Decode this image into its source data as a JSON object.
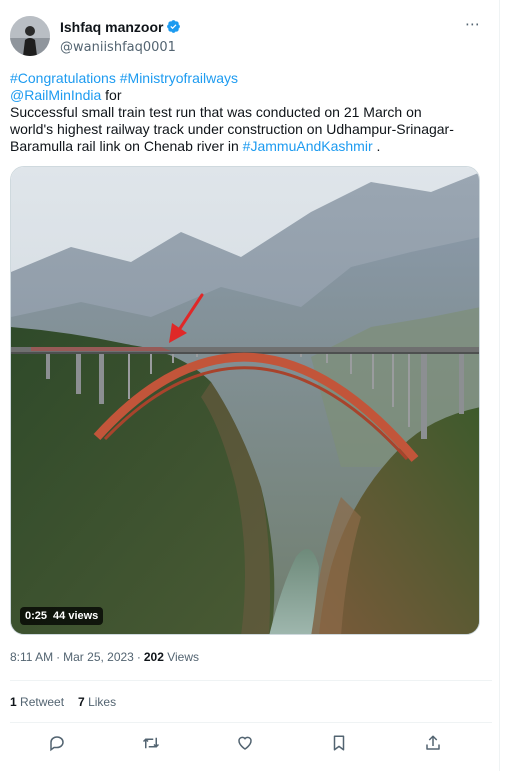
{
  "author": {
    "display_name": "Ishfaq manzoor",
    "handle": "@waniishfaq0001",
    "verified": true
  },
  "more_icon": "⋯",
  "tweet": {
    "line1": [
      {
        "text": "#Congratulations",
        "link": true
      },
      {
        "text": " ",
        "link": false
      },
      {
        "text": "#Ministryofrailways",
        "link": true
      }
    ],
    "line2_link": "@RailMinIndia",
    "line2_text": " for",
    "line3": "Successful small train test run that was conducted on 21 March on",
    "line4": "world's highest railway track under construction on Udhampur-Srinagar-",
    "line5_text": "Baramulla rail link on Chenab river in ",
    "line5_link": "#JammuAndKashmir",
    "line5_end": " ."
  },
  "video": {
    "duration": "0:25",
    "views": "44 views"
  },
  "meta": {
    "time": "8:11 AM",
    "separator": "·",
    "date": "Mar 25, 2023",
    "separator2": "·",
    "views_count": "202",
    "views_label": " Views"
  },
  "stats": {
    "retweet_count": "1",
    "retweet_label": " Retweet",
    "likes_count": "7",
    "likes_label": " Likes"
  },
  "actions": [
    "reply-icon",
    "retweet-icon",
    "like-icon",
    "bookmark-icon",
    "share-icon"
  ],
  "colors": {
    "link": "#1d9bf0",
    "secondary_text": "#536471",
    "primary_text": "#0f1419",
    "verified": "#1d9bf0",
    "bridge": "#c2553a"
  }
}
